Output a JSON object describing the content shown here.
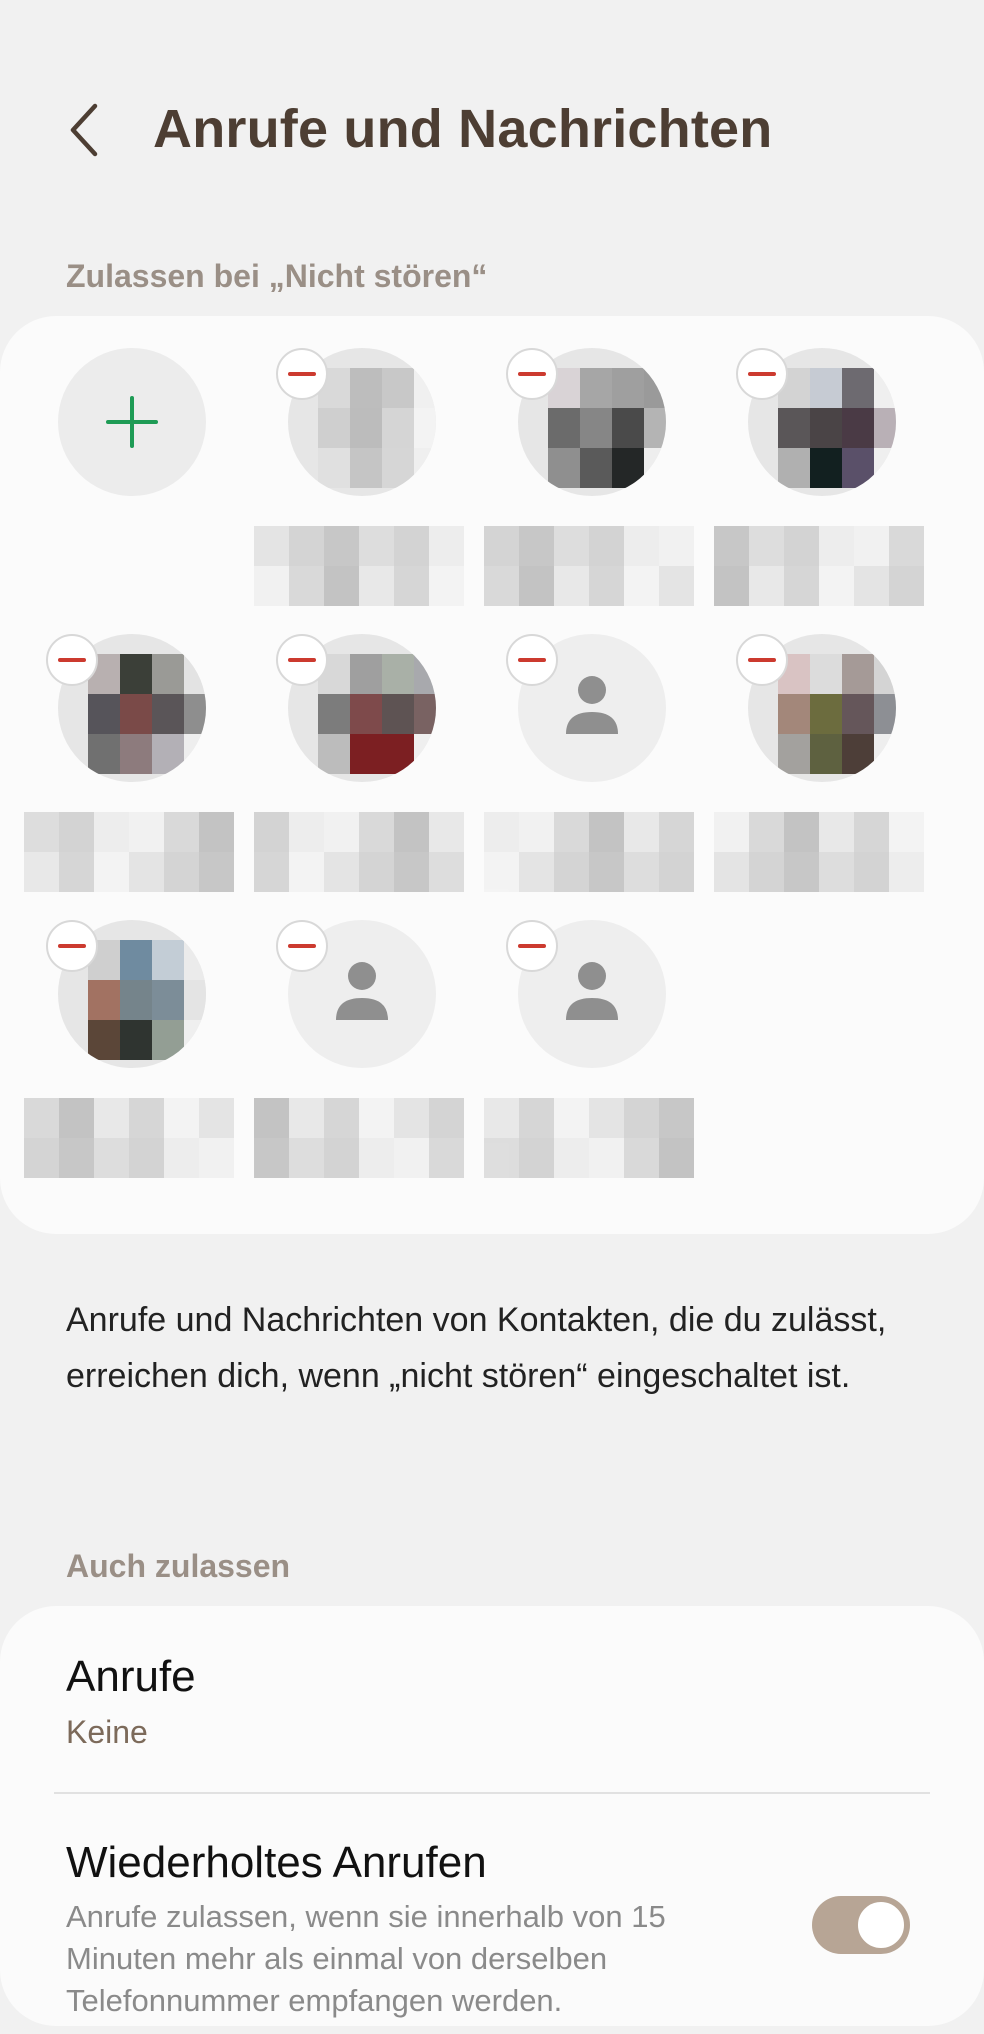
{
  "header": {
    "title": "Anrufe und Nachrichten"
  },
  "contacts_section": {
    "label": "Zulassen bei „Nicht stören“",
    "add_contact": {
      "label": ""
    },
    "contacts": [
      {
        "name": "",
        "avatar": "photo",
        "palette": [
          "#d9d9d9",
          "#bdbdbd",
          "#c8c8c8",
          "#f0f0f0",
          "#cfcfcf",
          "#bcbcbc",
          "#d5d5d5",
          "#f3f3f3",
          "#e0e0e0",
          "#c5c5c5",
          "#d6d6d6",
          "#efefef"
        ]
      },
      {
        "name": "",
        "avatar": "photo",
        "palette": [
          "#d9d3d6",
          "#a6a6a6",
          "#9f9f9f",
          "#9a9a9a",
          "#6b6b6b",
          "#868686",
          "#4a4a4a",
          "#b4b4b4",
          "#8f8f8f",
          "#5a5a5a",
          "#242727",
          "#eeeeee"
        ]
      },
      {
        "name": "",
        "avatar": "photo",
        "palette": [
          "#d3d3d3",
          "#c6cbd3",
          "#6d6a70",
          "#efefef",
          "#5a5658",
          "#4a4446",
          "#4a3a45",
          "#b9b0b6",
          "#b0b0b0",
          "#122020",
          "#5a5069",
          "#efefef"
        ]
      },
      {
        "name": "",
        "avatar": "photo",
        "palette": [
          "#b8b0b0",
          "#3b3f38",
          "#9a9a96",
          "#e3e3e3",
          "#56545a",
          "#7a4a48",
          "#5a5558",
          "#8e8e8e",
          "#707070",
          "#8d7b7d",
          "#b3b0b6",
          "#eeeeee"
        ]
      },
      {
        "name": "",
        "avatar": "photo",
        "palette": [
          "#d8d8d8",
          "#9f9f9f",
          "#a9b0a7",
          "#a8a9ad",
          "#7c7c7c",
          "#7e4a4b",
          "#5e5353",
          "#796262",
          "#bcbcbc",
          "#7c1f22",
          "#7c1f22",
          "#efefef"
        ]
      },
      {
        "name": "",
        "avatar": "person",
        "palette": []
      },
      {
        "name": "",
        "avatar": "photo",
        "palette": [
          "#d9c3c3",
          "#dcdcdc",
          "#a59a97",
          "#d4d4d4",
          "#a3877a",
          "#6c6c3e",
          "#65565a",
          "#8d8f94",
          "#a3a19e",
          "#5e6140",
          "#4d3e38",
          "#eeeeee"
        ]
      },
      {
        "name": "",
        "avatar": "photo",
        "palette": [
          "#cfcfcf",
          "#6f8ba0",
          "#c3cdd6",
          "#ebebeb",
          "#a27262",
          "#75848b",
          "#7c8d98",
          "#e4e4e4",
          "#5b4638",
          "#2f3430",
          "#939e94",
          "#efefef"
        ]
      },
      {
        "name": "",
        "avatar": "person",
        "palette": []
      },
      {
        "name": "",
        "avatar": "person",
        "palette": []
      }
    ]
  },
  "description": "Anrufe und Nachrichten von Kontakten, die du zulässt, erreichen dich, wenn „nicht stören“ eingeschaltet ist.",
  "also_allow": {
    "label": "Auch zulassen",
    "calls": {
      "title": "Anrufe",
      "value": "Keine"
    },
    "repeat_calls": {
      "title": "Wiederholtes Anrufen",
      "description": "Anrufe zulassen, wenn sie innerhalb von 15 Minuten mehr als einmal von derselben Telefonnummer empfangen werden.",
      "enabled": true
    }
  },
  "colors": {
    "accent": "#b7a595",
    "title": "#4d3e33",
    "add_icon": "#1e9b55",
    "remove_icon": "#cc3a2f"
  }
}
